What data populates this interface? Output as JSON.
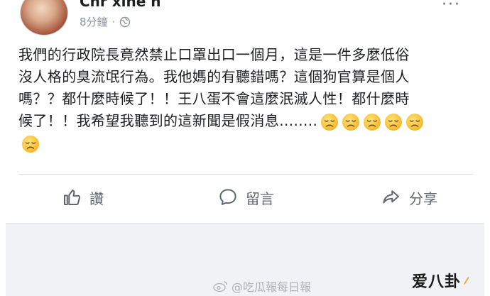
{
  "post": {
    "author_name": "Chr xine n",
    "timestamp": "8分鐘",
    "privacy_icon": "globe-icon",
    "text_lines": [
      "我們的行政院長竟然禁止口罩出口一個月，這是一件多麼低俗",
      "沒人格的臭流氓行為。我他媽的有聽錯嗎？這個狗官算是個人",
      "嗎？？都什麼時候了！！王八蛋不會這麼泯滅人性！都什麼時",
      "候了！！我希望我聽到的這新聞是假消息........"
    ],
    "emoji": "disappointed-face",
    "emoji_count": 6
  },
  "actions": {
    "like_label": "讚",
    "comment_label": "留言",
    "share_label": "分享"
  },
  "watermark": {
    "text": "@吃瓜報每日報"
  },
  "logo": {
    "text": "爱八卦",
    "accent": "#f5a623"
  },
  "colors": {
    "text": "#1c1e21",
    "secondary": "#606770",
    "background_gray": "#f0f2f5"
  }
}
